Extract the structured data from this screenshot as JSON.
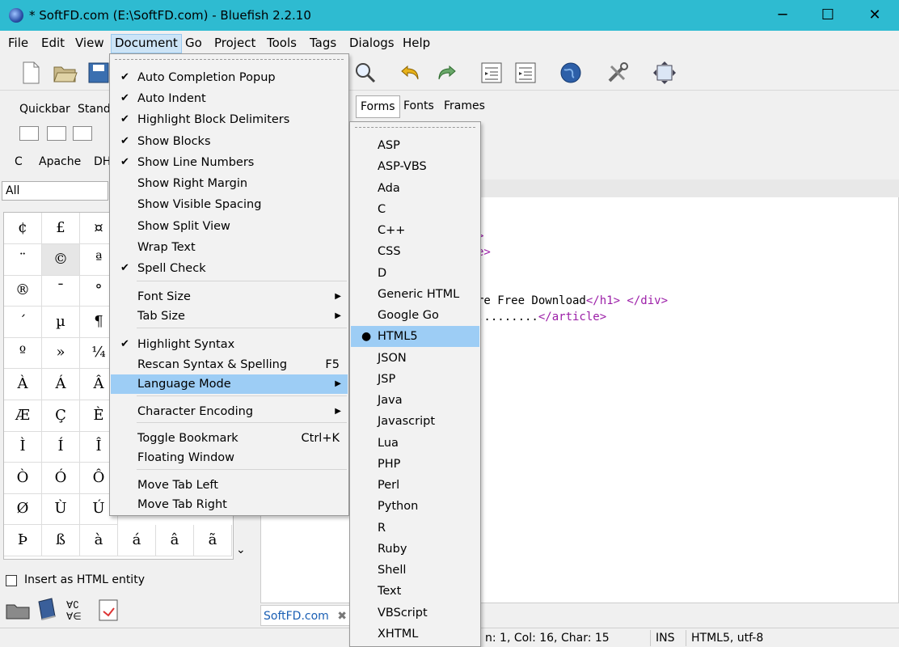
{
  "window": {
    "title": "* SoftFD.com (E:\\SoftFD.com) - Bluefish 2.2.10",
    "minimize": "─",
    "maximize": "☐",
    "close": "✕"
  },
  "menubar": [
    "File",
    "Edit",
    "View",
    "Document",
    "Go",
    "Project",
    "Tools",
    "Tags",
    "Dialogs",
    "Help"
  ],
  "left_tabs": [
    "Quickbar",
    "Stand"
  ],
  "language_tabs": [
    "C",
    "Apache",
    "DH"
  ],
  "filter_value": "All",
  "char_grid": [
    [
      "¢",
      "£",
      "¤"
    ],
    [
      "¨",
      "©",
      "ª"
    ],
    [
      "®",
      "¯",
      "°"
    ],
    [
      "´",
      "µ",
      "¶"
    ],
    [
      "º",
      "»",
      "¼"
    ],
    [
      "À",
      "Á",
      "Â"
    ],
    [
      "Æ",
      "Ç",
      "È"
    ],
    [
      "Ì",
      "Í",
      "Î"
    ],
    [
      "Ò",
      "Ó",
      "Ô"
    ],
    [
      "Ø",
      "Ù",
      "Ú"
    ],
    [
      "Þ",
      "ß",
      "à",
      "á",
      "â",
      "ã"
    ]
  ],
  "insert_html_label": "Insert as HTML entity",
  "right_tabs": [
    "Forms",
    "Fonts",
    "Frames"
  ],
  "code_lines": [
    {
      "pre": "",
      "kw": ">",
      "post": ""
    },
    {
      "pre": "",
      "kw": "e>",
      "post": ""
    },
    {
      "pre": "re Free Download",
      "kw": "</h1> </div>",
      "post": ""
    },
    {
      "pre": ".........",
      "kw": "</article>",
      "post": ""
    }
  ],
  "doc_tab": "SoftFD.com",
  "status": {
    "position": "n: 1, Col: 16, Char: 15",
    "mode": "INS",
    "encoding": "HTML5, utf-8"
  },
  "document_menu": [
    {
      "label": "Auto Completion Popup",
      "checked": true
    },
    {
      "label": "Auto Indent",
      "checked": true
    },
    {
      "label": "Highlight Block Delimiters",
      "checked": true
    },
    {
      "label": "Show Blocks",
      "checked": true
    },
    {
      "label": "Show Line Numbers",
      "checked": true
    },
    {
      "label": "Show Right Margin",
      "checked": false
    },
    {
      "label": "Show Visible Spacing",
      "checked": false
    },
    {
      "label": "Show Split View",
      "checked": false
    },
    {
      "label": "Wrap Text",
      "checked": false
    },
    {
      "label": "Spell Check",
      "checked": true
    },
    {
      "label": "Font Size",
      "submenu": true
    },
    {
      "label": "Tab Size",
      "submenu": true
    },
    {
      "label": "Highlight Syntax",
      "checked": true
    },
    {
      "label": "Rescan Syntax & Spelling",
      "accel": "F5"
    },
    {
      "label": "Language Mode",
      "submenu": true,
      "highlighted": true
    },
    {
      "label": "Character Encoding",
      "submenu": true
    },
    {
      "label": "Toggle Bookmark",
      "accel": "Ctrl+K"
    },
    {
      "label": "Floating Window"
    },
    {
      "label": "Move Tab Left"
    },
    {
      "label": "Move Tab Right"
    }
  ],
  "language_menu": [
    "ASP",
    "ASP-VBS",
    "Ada",
    "C",
    "C++",
    "CSS",
    "D",
    "Generic HTML",
    "Google Go",
    "HTML5",
    "JSON",
    "JSP",
    "Java",
    "Javascript",
    "Lua",
    "PHP",
    "Perl",
    "Python",
    "R",
    "Ruby",
    "Shell",
    "Text",
    "VBScript",
    "XHTML"
  ],
  "language_selected": "HTML5",
  "icons": {
    "check": "✔",
    "bullet": "●",
    "submenu_arrow": "▶",
    "close_tab": "✖",
    "scroll_down": "⌄"
  }
}
